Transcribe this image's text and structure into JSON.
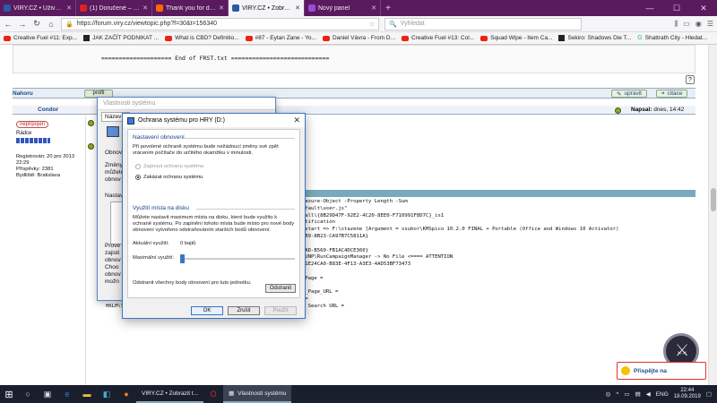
{
  "browser": {
    "tabs": [
      {
        "label": "VIRY.CZ • Uživatelský panel • Přihl...",
        "color": "#2a5aa8",
        "active": false
      },
      {
        "label": "(1) Doručené – Seznam Email",
        "color": "#d22",
        "active": false
      },
      {
        "label": "Thank you for downloading Av...",
        "color": "#f60",
        "active": false
      },
      {
        "label": "VIRY.CZ • Zobrazit téma - prosím o...",
        "color": "#2a5aa8",
        "active": true
      },
      {
        "label": "Nový panel",
        "color": "#9a4ad6",
        "active": false
      }
    ],
    "url": "https://forum.viry.cz/viewtopic.php?f=30&t=156340",
    "search_placeholder": "Vyhledat",
    "bookmarks": [
      {
        "label": "Creative Fuel #11: Exp...",
        "icon": "youtube-icon"
      },
      {
        "label": "JAK ZAČÍT PODNIKAT ...",
        "icon": "black-square-icon"
      },
      {
        "label": "What is CBD? Definitio...",
        "icon": "youtube-icon"
      },
      {
        "label": "#87 - Eytan Zane - Yo...",
        "icon": "youtube-icon"
      },
      {
        "label": "Daniel Vávra - From D...",
        "icon": "youtube-icon"
      },
      {
        "label": "Creative Fuel #13: Col...",
        "icon": "youtube-icon"
      },
      {
        "label": "Squad Wipe - Item Ca...",
        "icon": "youtube-icon"
      },
      {
        "label": "Sekiro: Shadows Die T...",
        "icon": "black-square-icon"
      },
      {
        "label": "Shattrath City - Hledat...",
        "icon": "google-icon"
      }
    ]
  },
  "forum": {
    "code_top_line": "==================== End of FRST.txt ============================",
    "nahoru": "Nahoru",
    "profile_btn": "profil",
    "edit_btn": "upravit",
    "quote_btn": "citace",
    "autor": "Condor",
    "posted_label": "Napsal:",
    "posted_date": "dnes, 14:42",
    "user_badge": "nepřipojen",
    "user_rank": "Rádce",
    "registered": "Registrován: 20 pro 2013",
    "registered_time": "22:29",
    "posts": "Příspěvky: 2381",
    "location": "Bydliště: Bratislava",
    "code_lines": [
      "                                                 ource -Force | Measure-Object -Property Length -Sum",
      "                                                 files\\5fwql5o5.default\\user.js\"",
      "",
      "                                                 entVersion\\Uninstall\\{8B29D47F-92E2-4C20-8EE0-F710991F8D7C}_is1",
      "",
      "                                                 ntel PTT EK Recertification",
      "                                                 AutoPico Daily Restart => F:\\stazene [Argument = ssubor\\KMSpico 10.2.0 FINAL + Portable (Office and Windows 10 Activator)",
      "",
      "                                                 {C2B4791D-8F67-4EB9-8B23-CA97B7C5811A}",
      "Task:                                            Update Manager",
      "Task:                                            {7A6E1206-465E-44AD-B560-FB1AC4DCE360}",
      "Task: {5A66194F-ED08-4819-8A66-8250CE7F22B5} - \\Microsoft\\Windows\\UNP\\RunCampaignManager -> No File <==== ATTENTION",
      "Task: {EF5B5BE-B08C-4EE9-BE61-5768BC04F679} - System32\\Tasks\\IMO-F1E24CA0-B83E-4F13-A3E3-4AD53BF73473",
      "HKLM\\Software\\Microsoft\\Internet Explorer\\Main,Search Page =",
      "HKLM\\Software\\Wow6432Node\\Microsoft\\Internet Explorer\\Main,Search Page =",
      "HKLM\\Software\\Microsoft\\Internet Explorer\\Main,Default_Page_URL =",
      "HKLM\\Software\\Wow6432Node\\Microsoft\\Internet Explorer\\Main,Default_Page_URL =",
      "HKLM\\Software\\Microsoft\\Internet Explorer\\Main,Default_Search_URL =",
      "HKLM\\Software\\Wow6432Node\\Microsoft\\Internet Explorer\\Main,Default Search URL ="
    ],
    "donate": "Přispějte na"
  },
  "back_dialog": {
    "title": "Vlastnosti systému",
    "tab_label": "Název p",
    "frag_obnov": "Obnov",
    "frag_zmeny": "Změny\nmůžete\nobnov",
    "frag_nast": "Nastave",
    "frag_prov": "Prove\nzajisti\nobnov",
    "frag_choo": "Choo\nobnov\nmožn"
  },
  "dialog": {
    "title": "Ochrana systému pro HRY (D:)",
    "section1": "Nastavení obnovení",
    "desc1": "Při povolené ochraně systému bude nežádoucí změny své zpět vrácenim počítače do určitého okamžiku v minulosti.",
    "radio_on": "Zapnout ochranu systému",
    "radio_off": "Zakázat ochranu systému",
    "section2": "Využití místa na disku",
    "desc2": "Můžete nastavit maximum místa na disku, které bude využito k ochraně systému. Po zaplnění tohoto místa bude místo pro nové body obnovení vytvořeno odstraňováním starších bodů obnovení.",
    "current_label": "Aktuální využití:",
    "current_value": "0 bajtů",
    "max_label": "Maximální využití:",
    "max_usage_fraction": 0.0,
    "delete_text": "Odstranit všechny body obnovení pro tuto jednotku.",
    "delete_btn": "Odstranit",
    "ok": "OK",
    "cancel": "Zrušit",
    "apply": "Použít"
  },
  "taskbar": {
    "app1": "VIRY.CZ • Zobrazit t...",
    "app2": "Vlastnosti systému",
    "lang": "ENG",
    "time": "22:44",
    "date": "18.09.2019"
  }
}
